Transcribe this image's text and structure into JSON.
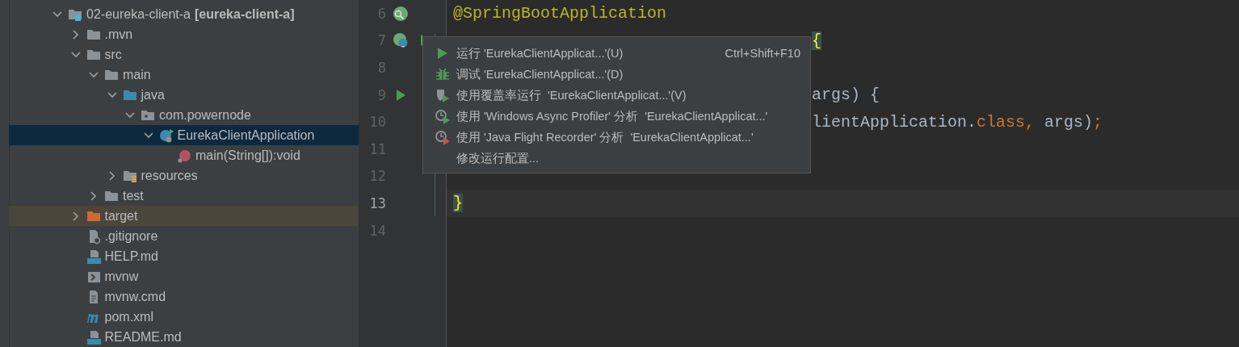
{
  "project_tree": {
    "items": [
      {
        "label": "02-eureka-client-a",
        "suffix": "[eureka-client-a]",
        "kind": "module",
        "expanded": true,
        "selected": false,
        "highlighted": false,
        "children": [
          {
            "label": ".mvn",
            "kind": "folder",
            "expanded": false,
            "selected": false,
            "highlighted": false
          },
          {
            "label": "src",
            "kind": "folder",
            "expanded": true,
            "selected": false,
            "highlighted": false,
            "children": [
              {
                "label": "main",
                "kind": "folder",
                "expanded": true,
                "selected": false,
                "highlighted": false,
                "children": [
                  {
                    "label": "java",
                    "kind": "source-folder",
                    "expanded": true,
                    "selected": false,
                    "highlighted": false,
                    "children": [
                      {
                        "label": "com.powernode",
                        "kind": "package",
                        "expanded": true,
                        "selected": false,
                        "highlighted": false,
                        "children": [
                          {
                            "label": "EurekaClientApplication",
                            "kind": "spring-class",
                            "expanded": true,
                            "selected": true,
                            "highlighted": false,
                            "children": [
                              {
                                "label": "main(String[]):void",
                                "kind": "method",
                                "selected": false,
                                "highlighted": false
                              }
                            ]
                          }
                        ]
                      }
                    ]
                  },
                  {
                    "label": "resources",
                    "kind": "resources-folder",
                    "expanded": false,
                    "selected": false,
                    "highlighted": false
                  }
                ]
              },
              {
                "label": "test",
                "kind": "folder",
                "expanded": false,
                "selected": false,
                "highlighted": false
              }
            ]
          },
          {
            "label": "target",
            "kind": "excluded-folder",
            "expanded": false,
            "selected": false,
            "highlighted": true
          },
          {
            "label": ".gitignore",
            "kind": "ignore-file",
            "selected": false,
            "highlighted": false
          },
          {
            "label": "HELP.md",
            "kind": "markdown",
            "selected": false,
            "highlighted": false
          },
          {
            "label": "mvnw",
            "kind": "script",
            "selected": false,
            "highlighted": false
          },
          {
            "label": "mvnw.cmd",
            "kind": "text-file",
            "selected": false,
            "highlighted": false
          },
          {
            "label": "pom.xml",
            "kind": "maven",
            "selected": false,
            "highlighted": false
          },
          {
            "label": "README.md",
            "kind": "markdown",
            "selected": false,
            "highlighted": false
          }
        ]
      }
    ]
  },
  "editor": {
    "lines": [
      {
        "number": "6",
        "current": false,
        "partial": false,
        "gutter_icons": [
          {
            "kind": "spring-search"
          }
        ],
        "segments": [
          {
            "text": "@SpringBootApplication",
            "kind": "annotation"
          }
        ]
      },
      {
        "number": "7",
        "current": false,
        "partial": true,
        "gutter_icons": [
          {
            "kind": "spring-endpoint"
          },
          {
            "kind": "run"
          }
        ],
        "segments": [
          {
            "text": "{",
            "kind": "brace-match"
          }
        ]
      },
      {
        "number": "8",
        "current": false,
        "partial": false
      },
      {
        "number": "9",
        "current": false,
        "partial": true,
        "gutter_icons": [
          {
            "kind": "run"
          }
        ],
        "segments": [
          {
            "text": "args) {",
            "kind": "plain"
          }
        ]
      },
      {
        "number": "10",
        "current": false,
        "partial": true,
        "segments": [
          {
            "text": "lientApplication.",
            "kind": "plain"
          },
          {
            "text": "class,",
            "kind": "keyword"
          },
          {
            "text": " args)",
            "kind": "plain"
          },
          {
            "text": ";",
            "kind": "keyword"
          }
        ]
      },
      {
        "number": "11",
        "current": false,
        "partial": false
      },
      {
        "number": "12",
        "current": false,
        "partial": false
      },
      {
        "number": "13",
        "current": true,
        "partial": false,
        "segments": [
          {
            "text": "}",
            "kind": "brace-match"
          }
        ]
      },
      {
        "number": "14",
        "current": false,
        "partial": false
      }
    ]
  },
  "context_menu": {
    "items": [
      {
        "kind": "run",
        "label": "运行 'EurekaClientApplicat...'(U)",
        "shortcut": "Ctrl+Shift+F10"
      },
      {
        "kind": "debug",
        "label": "调试 'EurekaClientApplicat...'(D)"
      },
      {
        "kind": "coverage",
        "label": "使用覆盖率运行  'EurekaClientApplicat...'(V)"
      },
      {
        "kind": "profiler",
        "label": "使用 'Windows Async Profiler' 分析  'EurekaClientApplicat...'"
      },
      {
        "kind": "recorder",
        "label": "使用 'Java Flight Recorder' 分析  'EurekaClientApplicat...'"
      },
      {
        "kind": "none",
        "label": "修改运行配置..."
      }
    ]
  }
}
